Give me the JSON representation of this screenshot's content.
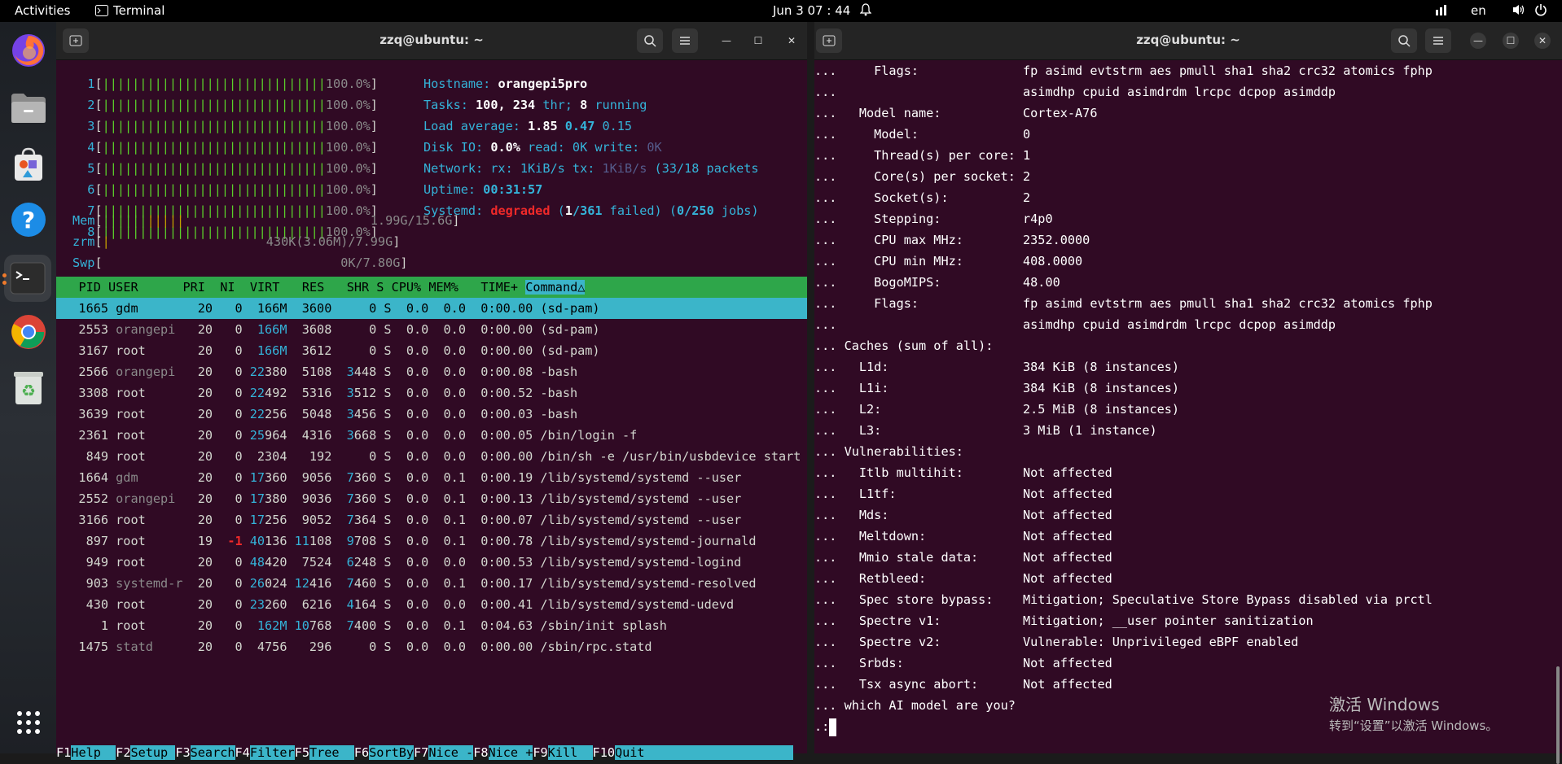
{
  "topbar": {
    "activities": "Activities",
    "app_name": "Terminal",
    "clock": "Jun 3  07 : 44",
    "lang": "en"
  },
  "dock": {
    "apps": [
      "firefox-icon",
      "files-icon",
      "app-center-icon",
      "help-icon",
      "terminal-icon",
      "chrome-icon",
      "trash-icon",
      "show-apps-icon"
    ]
  },
  "left_window": {
    "title": "zzq@ubuntu: ~",
    "meters": [
      {
        "label": "1",
        "bar": "||||||||||||||||||||||||||||||",
        "value": "100.0%"
      },
      {
        "label": "2",
        "bar": "||||||||||||||||||||||||||||||",
        "value": "100.0%"
      },
      {
        "label": "3",
        "bar": "||||||||||||||||||||||||||||||",
        "value": "100.0%"
      },
      {
        "label": "4",
        "bar": "||||||||||||||||||||||||||||||",
        "value": "100.0%"
      },
      {
        "label": "5",
        "bar": "||||||||||||||||||||||||||||||",
        "value": "100.0%"
      },
      {
        "label": "6",
        "bar": "||||||||||||||||||||||||||||||",
        "value": "100.0%"
      },
      {
        "label": "7",
        "bar": "||||||||||||||||||||||||||||||",
        "value": "100.0%"
      },
      {
        "label": "8",
        "bar": "||||||||||||||||||||||||||||||",
        "value": "100.0%"
      }
    ],
    "mem": {
      "label": "Mem",
      "bar": "||||||",
      "bar2": "|||||",
      "value": "1.99G/15.6G"
    },
    "zrm": {
      "label": "zrm",
      "bar": "|",
      "value": "430K(3.06M)/7.99G"
    },
    "swp": {
      "label": "Swp",
      "value": "0K/7.80G"
    },
    "info": {
      "hostname_label": "Hostname:",
      "hostname": "orangepi5pro",
      "tasks_label": "Tasks:",
      "tasks": "100,",
      "thr": "234",
      "thr_label": "thr;",
      "running": "8",
      "running_label": "running",
      "load_label": "Load average:",
      "load1": "1.85",
      "load5": "0.47",
      "load15": "0.15",
      "disk_label": "Disk IO:",
      "disk_pct": "0.0%",
      "disk_read_label": "read:",
      "disk_read": "0K",
      "disk_write_label": "write:",
      "disk_write": "0K",
      "net_label": "Network: rx:",
      "net_rx": "1KiB/s",
      "net_tx_label": "tx:",
      "net_tx": "1KiB/s",
      "net_packets": "(33/18 packets",
      "uptime_label": "Uptime:",
      "uptime": "00:31:57",
      "systemd_label": "Systemd:",
      "systemd_state": "degraded",
      "systemd_failed": "1",
      "systemd_units": "/361",
      "systemd_failed_label": "failed)",
      "systemd_jobs": "0/250",
      "systemd_jobs_label": "jobs)"
    },
    "table_header": {
      "pid": "PID",
      "user": "USER",
      "pri": "PRI",
      "ni": "NI",
      "virt": "VIRT",
      "res": "RES",
      "shr": "SHR",
      "s": "S",
      "cpu": "CPU%",
      "mem": "MEM%",
      "time": "TIME+",
      "command": "Command△"
    },
    "processes": [
      {
        "pid": "1665",
        "user": "gdm",
        "pri": "20",
        "ni": "0",
        "virt": "166M",
        "res": "3600",
        "shr": "0",
        "s": "S",
        "cpu": "0.0",
        "mem": "0.0",
        "time": "0:00.00",
        "cmd": "(sd-pam)"
      },
      {
        "pid": "2553",
        "user": "orangepi",
        "pri": "20",
        "ni": "0",
        "virt": "166M",
        "res": "3608",
        "shr": "0",
        "s": "S",
        "cpu": "0.0",
        "mem": "0.0",
        "time": "0:00.00",
        "cmd": "(sd-pam)"
      },
      {
        "pid": "3167",
        "user": "root",
        "pri": "20",
        "ni": "0",
        "virt": "166M",
        "res": "3612",
        "shr": "0",
        "s": "S",
        "cpu": "0.0",
        "mem": "0.0",
        "time": "0:00.00",
        "cmd": "(sd-pam)"
      },
      {
        "pid": "2566",
        "user": "orangepi",
        "pri": "20",
        "ni": "0",
        "virt": "22380",
        "res": "5108",
        "shr": "3448",
        "s": "S",
        "cpu": "0.0",
        "mem": "0.0",
        "time": "0:00.08",
        "cmd": "-bash"
      },
      {
        "pid": "3308",
        "user": "root",
        "pri": "20",
        "ni": "0",
        "virt": "22492",
        "res": "5316",
        "shr": "3512",
        "s": "S",
        "cpu": "0.0",
        "mem": "0.0",
        "time": "0:00.52",
        "cmd": "-bash"
      },
      {
        "pid": "3639",
        "user": "root",
        "pri": "20",
        "ni": "0",
        "virt": "22256",
        "res": "5048",
        "shr": "3456",
        "s": "S",
        "cpu": "0.0",
        "mem": "0.0",
        "time": "0:00.03",
        "cmd": "-bash"
      },
      {
        "pid": "2361",
        "user": "root",
        "pri": "20",
        "ni": "0",
        "virt": "25964",
        "res": "4316",
        "shr": "3668",
        "s": "S",
        "cpu": "0.0",
        "mem": "0.0",
        "time": "0:00.05",
        "cmd": "/bin/login -f"
      },
      {
        "pid": "849",
        "user": "root",
        "pri": "20",
        "ni": "0",
        "virt": "2304",
        "res": "192",
        "shr": "0",
        "s": "S",
        "cpu": "0.0",
        "mem": "0.0",
        "time": "0:00.00",
        "cmd": "/bin/sh -e /usr/bin/usbdevice start"
      },
      {
        "pid": "1664",
        "user": "gdm",
        "pri": "20",
        "ni": "0",
        "virt": "17360",
        "res": "9056",
        "shr": "7360",
        "s": "S",
        "cpu": "0.0",
        "mem": "0.1",
        "time": "0:00.19",
        "cmd": "/lib/systemd/systemd --user"
      },
      {
        "pid": "2552",
        "user": "orangepi",
        "pri": "20",
        "ni": "0",
        "virt": "17380",
        "res": "9036",
        "shr": "7360",
        "s": "S",
        "cpu": "0.0",
        "mem": "0.1",
        "time": "0:00.13",
        "cmd": "/lib/systemd/systemd --user"
      },
      {
        "pid": "3166",
        "user": "root",
        "pri": "20",
        "ni": "0",
        "virt": "17256",
        "res": "9052",
        "shr": "7364",
        "s": "S",
        "cpu": "0.0",
        "mem": "0.1",
        "time": "0:00.07",
        "cmd": "/lib/systemd/systemd --user"
      },
      {
        "pid": "897",
        "user": "root",
        "pri": "19",
        "ni": "-1",
        "virt": "40136",
        "res": "11108",
        "shr": "9708",
        "s": "S",
        "cpu": "0.0",
        "mem": "0.1",
        "time": "0:00.78",
        "cmd": "/lib/systemd/systemd-journald"
      },
      {
        "pid": "949",
        "user": "root",
        "pri": "20",
        "ni": "0",
        "virt": "48420",
        "res": "7524",
        "shr": "6248",
        "s": "S",
        "cpu": "0.0",
        "mem": "0.0",
        "time": "0:00.53",
        "cmd": "/lib/systemd/systemd-logind"
      },
      {
        "pid": "903",
        "user": "systemd-r",
        "pri": "20",
        "ni": "0",
        "virt": "26024",
        "res": "12416",
        "shr": "7460",
        "s": "S",
        "cpu": "0.0",
        "mem": "0.1",
        "time": "0:00.17",
        "cmd": "/lib/systemd/systemd-resolved"
      },
      {
        "pid": "430",
        "user": "root",
        "pri": "20",
        "ni": "0",
        "virt": "23260",
        "res": "6216",
        "shr": "4164",
        "s": "S",
        "cpu": "0.0",
        "mem": "0.0",
        "time": "0:00.41",
        "cmd": "/lib/systemd/systemd-udevd"
      },
      {
        "pid": "1",
        "user": "root",
        "pri": "20",
        "ni": "0",
        "virt": "162M",
        "res": "10768",
        "shr": "7400",
        "s": "S",
        "cpu": "0.0",
        "mem": "0.1",
        "time": "0:04.63",
        "cmd": "/sbin/init splash"
      },
      {
        "pid": "1475",
        "user": "statd",
        "pri": "20",
        "ni": "0",
        "virt": "4756",
        "res": "296",
        "shr": "0",
        "s": "S",
        "cpu": "0.0",
        "mem": "0.0",
        "time": "0:00.00",
        "cmd": "/sbin/rpc.statd"
      }
    ],
    "fkeys": [
      {
        "key": "F1",
        "label": "Help  "
      },
      {
        "key": "F2",
        "label": "Setup "
      },
      {
        "key": "F3",
        "label": "Search"
      },
      {
        "key": "F4",
        "label": "Filter"
      },
      {
        "key": "F5",
        "label": "Tree  "
      },
      {
        "key": "F6",
        "label": "SortBy"
      },
      {
        "key": "F7",
        "label": "Nice -"
      },
      {
        "key": "F8",
        "label": "Nice +"
      },
      {
        "key": "F9",
        "label": "Kill  "
      },
      {
        "key": "F10",
        "label": "Quit  "
      }
    ]
  },
  "right_window": {
    "title": "zzq@ubuntu: ~",
    "lines": [
      "...     Flags:              fp asimd evtstrm aes pmull sha1 sha2 crc32 atomics fphp",
      "...                         asimdhp cpuid asimdrdm lrcpc dcpop asimddp",
      "...   Model name:           Cortex-A76",
      "...     Model:              0",
      "...     Thread(s) per core: 1",
      "...     Core(s) per socket: 2",
      "...     Socket(s):          2",
      "...     Stepping:           r4p0",
      "...     CPU max MHz:        2352.0000",
      "...     CPU min MHz:        408.0000",
      "...     BogoMIPS:           48.00",
      "...     Flags:              fp asimd evtstrm aes pmull sha1 sha2 crc32 atomics fphp",
      "...                         asimdhp cpuid asimdrdm lrcpc dcpop asimddp",
      "... Caches (sum of all):",
      "...   L1d:                  384 KiB (8 instances)",
      "...   L1i:                  384 KiB (8 instances)",
      "...   L2:                   2.5 MiB (8 instances)",
      "...   L3:                   3 MiB (1 instance)",
      "... Vulnerabilities:",
      "...   Itlb multihit:        Not affected",
      "...   L1tf:                 Not affected",
      "...   Mds:                  Not affected",
      "...   Meltdown:             Not affected",
      "...   Mmio stale data:      Not affected",
      "...   Retbleed:             Not affected",
      "...   Spec store bypass:    Mitigation; Speculative Store Bypass disabled via prctl",
      "...   Spectre v1:           Mitigation; __user pointer sanitization",
      "...   Spectre v2:           Vulnerable: Unprivileged eBPF enabled",
      "...   Srbds:                Not affected",
      "...   Tsx async abort:      Not affected",
      "... which AI model are you?"
    ],
    "prompt": ".:"
  },
  "watermark": {
    "line1": "激活 Windows",
    "line2": "转到“设置”以激活 Windows。"
  }
}
